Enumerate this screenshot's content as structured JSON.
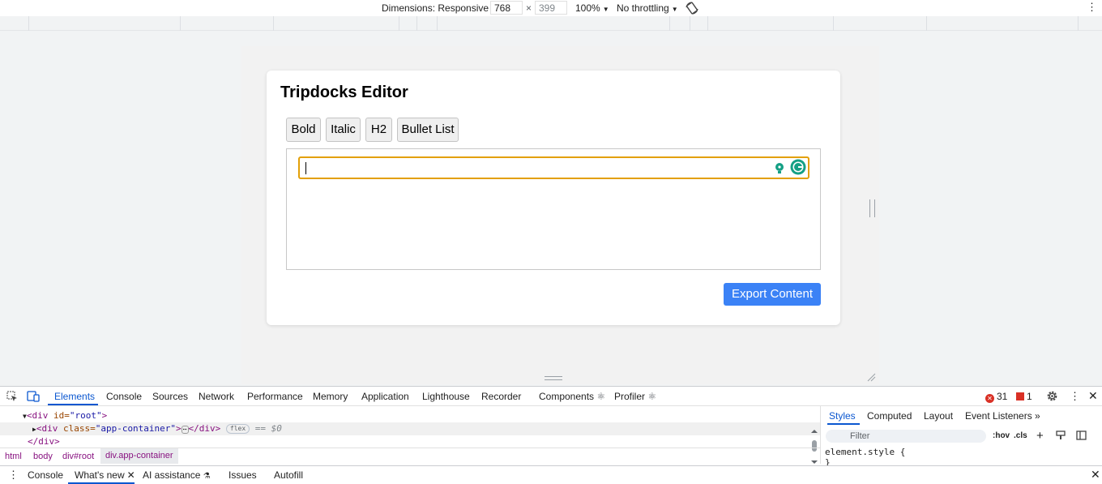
{
  "device_toolbar": {
    "dimensions_label": "Dimensions: Responsive",
    "width": "768",
    "times": "×",
    "height": "399",
    "zoom": "100%",
    "throttling": "No throttling",
    "more": "⋮"
  },
  "app": {
    "title": "Tripdocks Editor",
    "buttons": {
      "bold": "Bold",
      "italic": "Italic",
      "h2": "H2",
      "bullet_list": "Bullet List"
    },
    "export_label": "Export Content"
  },
  "devtools": {
    "tabs": [
      "Elements",
      "Console",
      "Sources",
      "Network",
      "Performance",
      "Memory",
      "Application",
      "Lighthouse",
      "Recorder",
      "Components",
      "Profiler"
    ],
    "error_count": "31",
    "issue_count": "1",
    "dom": {
      "line1_tag_open": "<div ",
      "line1_attr": "id=",
      "line1_val": "\"root\"",
      "line1_close": ">",
      "line2_tag_open": "<div ",
      "line2_attr": "class=",
      "line2_val": "\"app-container\"",
      "line2_mid": ">",
      "line2_ellipsis": "⋯",
      "line2_end": "</div>",
      "line2_badge": "flex",
      "line2_dollar": "== $0",
      "line3": "</div>"
    },
    "breadcrumbs": [
      "html",
      "body",
      "div#root",
      "div.app-container"
    ],
    "styles_tabs": [
      "Styles",
      "Computed",
      "Layout",
      "Event Listeners"
    ],
    "more_tabs": "»",
    "filter_placeholder": "Filter",
    "hov": ":hov",
    "cls": ".cls",
    "element_style": "element.style {",
    "element_style_close": "}",
    "drawer_tabs": {
      "console": "Console",
      "whats_new": "What's new",
      "ai_assistance": "AI assistance",
      "issues": "Issues",
      "autofill": "Autofill"
    }
  },
  "colors": {
    "accent": "#3b82f6",
    "focus_border": "#e3a008",
    "devtools_active": "#0b57d0",
    "error": "#d93025"
  }
}
